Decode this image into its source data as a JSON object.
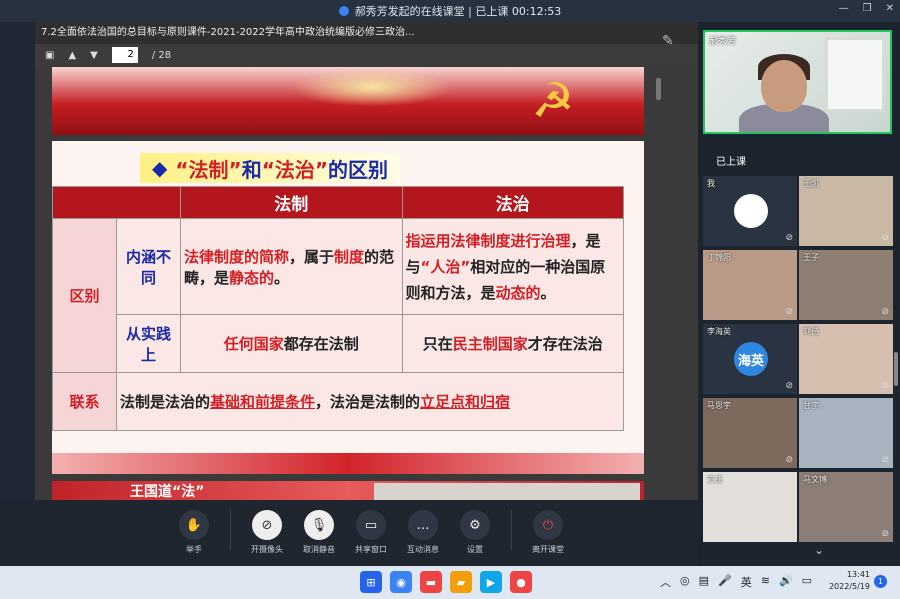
{
  "window": {
    "title": "郝秀芳发起的在线课堂 | 已上课 00:12:53"
  },
  "document": {
    "filename": "7.2全面依法治国的总目标与原则课件-2021-2022学年高中政治统编版必修三政治...",
    "current_page": "2",
    "total_pages": "/ 28"
  },
  "slide": {
    "heading_diamond": "◆",
    "heading_q1": "“法制”",
    "heading_and": "和",
    "heading_q2": "“法治”",
    "heading_rest": "的区别",
    "col_fazhi_system": "法制",
    "col_fazhi_rule": "法治",
    "row_diff": "区别",
    "row_connotation": "内涵不同",
    "row_practice": "从实践上",
    "row_link": "联系",
    "connotation_system_red": "法律制度的简称",
    "connotation_system_a": "，属于",
    "connotation_system_red2": "制度",
    "connotation_system_b": "的范畴，是",
    "connotation_system_red3": "静态的",
    "connotation_system_c": "。",
    "connotation_rule_red": "指运用法律制度进行治理",
    "connotation_rule_a": "，是与",
    "connotation_rule_red2": "“人治”",
    "connotation_rule_b": "相对应的一种治国原则和方法，是",
    "connotation_rule_red3": "动态的",
    "connotation_rule_c": "。",
    "practice_system_red": "任何国家",
    "practice_system_rest": "都存在法制",
    "practice_rule_a": "只在",
    "practice_rule_red": "民主制国家",
    "practice_rule_b": "才存在法治",
    "link_a": "法制是法治的",
    "link_red1": "基础和前提条件",
    "link_b": "，法治是法制的",
    "link_red2": "立足点和归宿",
    "next_slide_title": "王国道“法”"
  },
  "toolbar": {
    "raise_hand": "举手",
    "camera": "开摄像头",
    "unmute": "取消静音",
    "share": "共享窗口",
    "interact": "互动消息",
    "settings": "设置",
    "leave": "离开课堂"
  },
  "participants": {
    "host": "郝秀芳",
    "status": "已上课",
    "tiles": [
      {
        "name": "我"
      },
      {
        "name": "王凯"
      },
      {
        "name": "丁锦阳"
      },
      {
        "name": "王子"
      },
      {
        "name": "李海英",
        "avatar": "海英"
      },
      {
        "name": "刘诗"
      },
      {
        "name": "马思宇"
      },
      {
        "name": "甘宇"
      },
      {
        "name": "方正"
      },
      {
        "name": "马文博"
      }
    ]
  },
  "taskbar": {
    "ime": "英",
    "time": "13:41",
    "date": "2022/5/19",
    "notifications": "1"
  }
}
